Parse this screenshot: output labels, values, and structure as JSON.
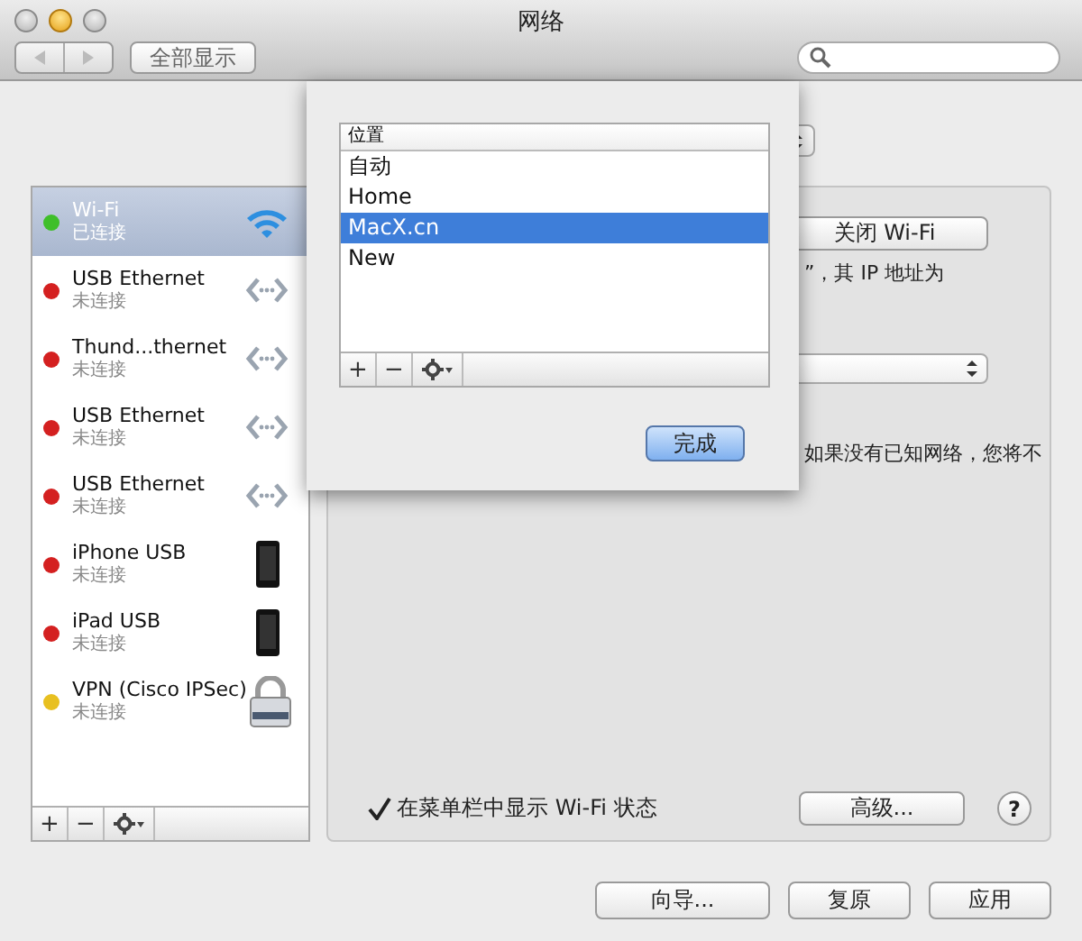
{
  "window": {
    "title": "网络"
  },
  "toolbar": {
    "show_all_button": "全部显示"
  },
  "services": [
    {
      "name": "Wi-Fi",
      "status": "已连接",
      "color": "#3fbf2a",
      "kind": "wifi",
      "selected": true
    },
    {
      "name": "USB Ethernet",
      "status": "未连接",
      "color": "#d42020",
      "kind": "ethernet",
      "selected": false
    },
    {
      "name": "Thund...thernet",
      "status": "未连接",
      "color": "#d42020",
      "kind": "ethernet",
      "selected": false
    },
    {
      "name": "USB Ethernet",
      "status": "未连接",
      "color": "#d42020",
      "kind": "ethernet",
      "selected": false
    },
    {
      "name": "USB Ethernet",
      "status": "未连接",
      "color": "#d42020",
      "kind": "ethernet",
      "selected": false
    },
    {
      "name": "iPhone USB",
      "status": "未连接",
      "color": "#d42020",
      "kind": "phone",
      "selected": false
    },
    {
      "name": "iPad USB",
      "status": "未连接",
      "color": "#d42020",
      "kind": "phone",
      "selected": false
    },
    {
      "name": "VPN (Cisco IPSec)",
      "status": "未连接",
      "color": "#e8c020",
      "kind": "vpn",
      "selected": false
    }
  ],
  "service_buttons": [
    "+",
    "−"
  ],
  "wifi_panel": {
    "turn_off_button": "关闭 Wi-Fi",
    "status_text": "”，其 IP 地址为",
    "note": "如果没有已知网络，您将不",
    "show_in_menu_bar": {
      "label": "在菜单栏中显示 Wi-Fi 状态",
      "checked": true
    },
    "advanced_button": "高级...",
    "help_button": "?"
  },
  "locations_sheet": {
    "column": "位置",
    "items": [
      {
        "label": "自动",
        "selected": false
      },
      {
        "label": "Home",
        "selected": false
      },
      {
        "label": "MacX.cn",
        "selected": true
      },
      {
        "label": "New",
        "selected": false
      }
    ],
    "list_buttons": [
      "+",
      "−"
    ],
    "done_button": "完成"
  },
  "buttons": [
    "向导...",
    "复原",
    "应用"
  ]
}
